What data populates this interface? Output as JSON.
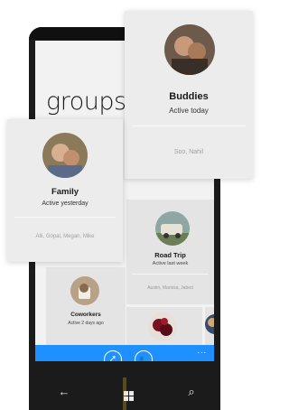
{
  "page": {
    "title": "groups"
  },
  "tiles": {
    "road_trip": {
      "name": "Road Trip",
      "status": "Active last week",
      "members": "Austin, Marissa, Jabed"
    },
    "coworkers": {
      "name": "Coworkers",
      "status": "Active 2 days ago"
    }
  },
  "cards": {
    "buddies": {
      "name": "Buddies",
      "status": "Active today",
      "members": "Soo, Nahil"
    },
    "family": {
      "name": "Family",
      "status": "Active yesterday",
      "members": "Alli, Gopal, Megan, Mike"
    }
  },
  "app_bar": {
    "buttons": [
      {
        "icon": "compass-icon",
        "glyph": "➚"
      },
      {
        "icon": "people-icon",
        "glyph": "👥"
      }
    ],
    "more": "..."
  },
  "nav_bar": {
    "back_glyph": "←",
    "search_glyph": "⌕"
  },
  "colors": {
    "accent": "#1e90ff",
    "phone": "#1b1b1b",
    "tile": "#e4e4e4",
    "card": "#ececec"
  }
}
